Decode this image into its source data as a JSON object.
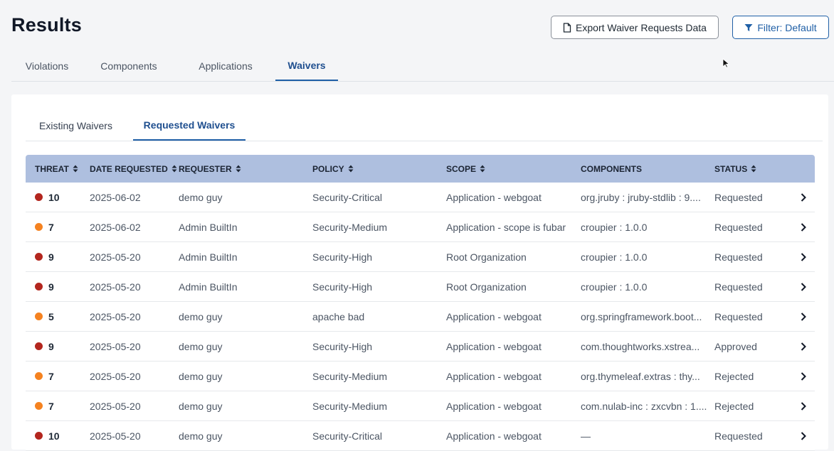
{
  "page": {
    "title": "Results"
  },
  "header": {
    "export_label": "Export Waiver Requests Data",
    "filter_label": "Filter: Default"
  },
  "main_tabs": [
    {
      "label": "Violations",
      "active": false
    },
    {
      "label": "Components",
      "active": false
    },
    {
      "label": "Applications",
      "active": false
    },
    {
      "label": "Waivers",
      "active": true
    }
  ],
  "sub_tabs": [
    {
      "label": "Existing Waivers",
      "active": false
    },
    {
      "label": "Requested Waivers",
      "active": true
    }
  ],
  "table": {
    "columns": [
      {
        "label": "THREAT",
        "sortable": true
      },
      {
        "label": "DATE REQUESTED",
        "sortable": true
      },
      {
        "label": "REQUESTER",
        "sortable": true
      },
      {
        "label": "POLICY",
        "sortable": true
      },
      {
        "label": "SCOPE",
        "sortable": true
      },
      {
        "label": "COMPONENTS",
        "sortable": false
      },
      {
        "label": "STATUS",
        "sortable": true
      }
    ],
    "rows": [
      {
        "threat": "10",
        "level": "critical",
        "date": "2025-06-02",
        "requester": "demo guy",
        "policy": "Security-Critical",
        "scope": "Application - webgoat",
        "components": "org.jruby : jruby-stdlib : 9....",
        "status": "Requested"
      },
      {
        "threat": "7",
        "level": "medium",
        "date": "2025-06-02",
        "requester": "Admin BuiltIn",
        "policy": "Security-Medium",
        "scope": "Application - scope is fubar",
        "components": "croupier : 1.0.0",
        "status": "Requested"
      },
      {
        "threat": "9",
        "level": "critical",
        "date": "2025-05-20",
        "requester": "Admin BuiltIn",
        "policy": "Security-High",
        "scope": "Root Organization",
        "components": "croupier : 1.0.0",
        "status": "Requested"
      },
      {
        "threat": "9",
        "level": "critical",
        "date": "2025-05-20",
        "requester": "Admin BuiltIn",
        "policy": "Security-High",
        "scope": "Root Organization",
        "components": "croupier : 1.0.0",
        "status": "Requested"
      },
      {
        "threat": "5",
        "level": "medium",
        "date": "2025-05-20",
        "requester": "demo guy",
        "policy": "apache bad",
        "scope": "Application - webgoat",
        "components": "org.springframework.boot...",
        "status": "Requested"
      },
      {
        "threat": "9",
        "level": "critical",
        "date": "2025-05-20",
        "requester": "demo guy",
        "policy": "Security-High",
        "scope": "Application - webgoat",
        "components": "com.thoughtworks.xstrea...",
        "status": "Approved"
      },
      {
        "threat": "7",
        "level": "medium",
        "date": "2025-05-20",
        "requester": "demo guy",
        "policy": "Security-Medium",
        "scope": "Application - webgoat",
        "components": "org.thymeleaf.extras : thy...",
        "status": "Rejected"
      },
      {
        "threat": "7",
        "level": "medium",
        "date": "2025-05-20",
        "requester": "demo guy",
        "policy": "Security-Medium",
        "scope": "Application - webgoat",
        "components": "com.nulab-inc : zxcvbn : 1....",
        "status": "Rejected"
      },
      {
        "threat": "10",
        "level": "critical",
        "date": "2025-05-20",
        "requester": "demo guy",
        "policy": "Security-Critical",
        "scope": "Application - webgoat",
        "components": "—",
        "status": "Requested"
      }
    ]
  },
  "colors": {
    "critical": "#b3261e",
    "medium": "#f58220",
    "accent": "#1f5fa6",
    "header_bg": "#aebfdf"
  },
  "icons": {
    "export": "document-icon",
    "filter": "filter-icon",
    "sort": "sort-icon",
    "row_action": "chevron-right-icon",
    "pointer": "mouse-cursor-icon"
  }
}
